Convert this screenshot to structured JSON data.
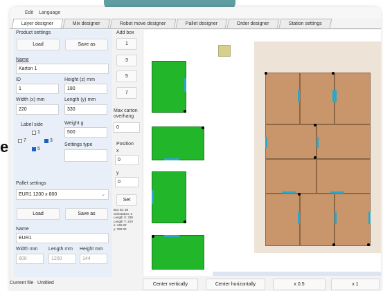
{
  "menu": {
    "edit": "Edit",
    "language": "Language"
  },
  "tabs": [
    {
      "label": "Layer designer"
    },
    {
      "label": "Mix designer"
    },
    {
      "label": "Robot move designer"
    },
    {
      "label": "Pallet designer"
    },
    {
      "label": "Order designer"
    },
    {
      "label": "Station settings"
    }
  ],
  "product": {
    "section_title": "Product settings",
    "load": "Load",
    "save_as": "Save as",
    "name_label": "Name",
    "name_value": "Karton 1",
    "id_label": "ID",
    "id_value": "1",
    "height_label": "Height (z) mm",
    "height_value": "180",
    "width_label": "Width (x) mm",
    "width_value": "220",
    "length_label": "Length (y) mm",
    "length_value": "330",
    "label_side": "Label side",
    "weight_label": "Weight g",
    "weight_value": "500",
    "settings_type_label": "Settings type",
    "chk": [
      "1",
      "7",
      "3",
      "5"
    ]
  },
  "pallet": {
    "section_title": "Pallet settings",
    "type_value": "EUR1 1200 x 800",
    "load": "Load",
    "save_as": "Save as",
    "name_label": "Name",
    "name_value": "EUR1",
    "width_label": "Width mm",
    "width_value": "800",
    "length_label": "Length mm",
    "length_value": "1200",
    "height_label": "Height mm",
    "height_value": "144"
  },
  "addbox": {
    "title": "Add box",
    "buttons": [
      "1",
      "3",
      "5",
      "7"
    ],
    "overhang_label": "Max carton overhang",
    "overhang_value": "0",
    "position_label": "Position",
    "x_label": "x",
    "x_value": "0",
    "y_label": "y",
    "y_value": "0",
    "set": "Set",
    "info": "Box ID: 38\nOrientation: 3\nLength X: 330\nLength Y: 220\nx: 445.00\ny: 390.00"
  },
  "bottom": {
    "current_file_label": "Current file",
    "current_file_value": "Untitled",
    "center_vertically": "Center vertically",
    "center_horizontally": "Center horizontally",
    "zoom_half": "x 0.5",
    "zoom_one": "x 1"
  },
  "deco": {
    "letter": "e"
  },
  "colors": {
    "box_green": "#22b62a",
    "box_brown": "#c8966a",
    "label_marker": "#2aa7c9",
    "accent_teal": "#5f9ea3"
  }
}
